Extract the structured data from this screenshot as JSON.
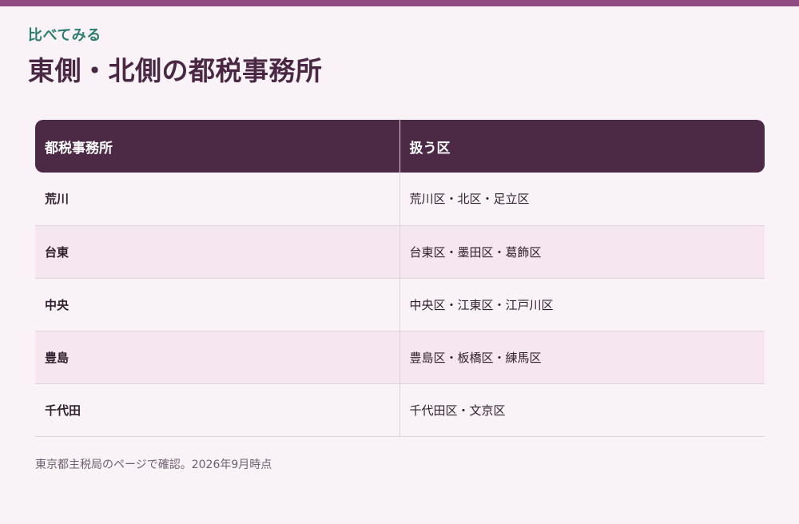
{
  "header": {
    "eyebrow": "比べてみる",
    "title": "東側・北側の都税事務所"
  },
  "table": {
    "columns": [
      "都税事務所",
      "扱う区"
    ],
    "rows": [
      {
        "office": "荒川",
        "wards": "荒川区・北区・足立区"
      },
      {
        "office": "台東",
        "wards": "台東区・墨田区・葛飾区"
      },
      {
        "office": "中央",
        "wards": "中央区・江東区・江戸川区"
      },
      {
        "office": "豊島",
        "wards": "豊島区・板橋区・練馬区"
      },
      {
        "office": "千代田",
        "wards": "千代田区・文京区"
      }
    ]
  },
  "footnote": "東京都主税局のページで確認。2026年9月時点",
  "colors": {
    "accent_bar": "#8f4b82",
    "eyebrow": "#2e7d71",
    "header_bg": "#4c2a46",
    "row_alt": "#f5e6f0"
  }
}
